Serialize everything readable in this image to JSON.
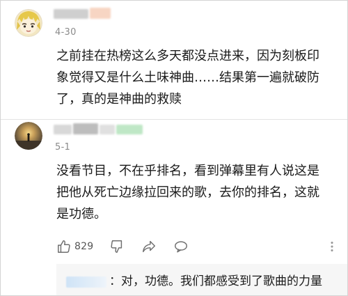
{
  "comments": [
    {
      "avatar_icon": "anime-character-avatar-icon",
      "date": "4-30",
      "lines": [
        "之前挂在热榜这么多天都没点进来，因为刻板印",
        "象觉得又是什么土味神曲……结果第一遍就破防",
        "了，真的是神曲的救赎"
      ]
    },
    {
      "avatar_icon": "sunset-silhouette-avatar-icon",
      "date": "5-1",
      "lines": [
        "没看节目，不在乎排名，看到弹幕里有人说这是",
        "把他从死亡边缘拉回来的歌，去你的排名，这就",
        "是功德。"
      ],
      "actions": {
        "like_icon": "thumbs-up-icon",
        "like_count": "829",
        "dislike_icon": "thumbs-down-icon",
        "share_icon": "share-arrow-icon",
        "comment_icon": "speech-bubble-icon",
        "more_icon": "vertical-dots-icon"
      },
      "reply": {
        "text": "：对，功德。我们都感受到了歌曲的力量"
      }
    }
  ],
  "colors": {
    "text": "#1a1a1a",
    "meta": "#8a8a8a",
    "icon": "#6f6f6f",
    "reply_bg": "#f6f6f6"
  }
}
